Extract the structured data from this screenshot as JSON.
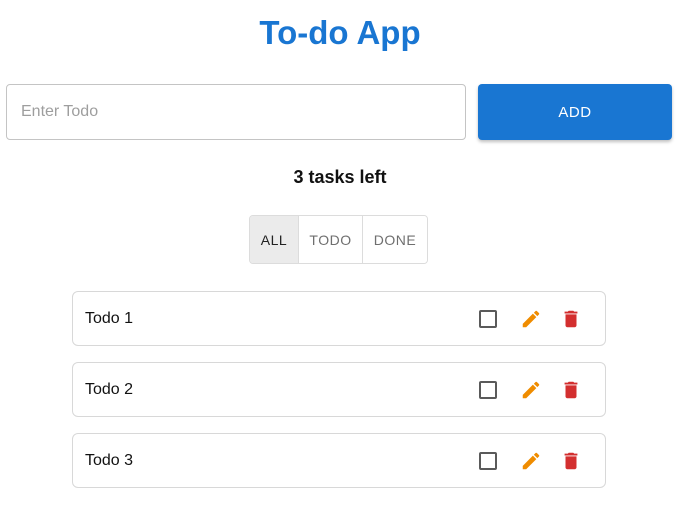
{
  "app": {
    "title": "To-do App"
  },
  "input": {
    "placeholder": "Enter Todo",
    "value": ""
  },
  "add_button": {
    "label": "ADD"
  },
  "status": {
    "tasks_left": "3 tasks left"
  },
  "filters": [
    {
      "label": "ALL",
      "selected": true
    },
    {
      "label": "TODO",
      "selected": false
    },
    {
      "label": "DONE",
      "selected": false
    }
  ],
  "todos": [
    {
      "text": "Todo 1",
      "done": false
    },
    {
      "text": "Todo 2",
      "done": false
    },
    {
      "text": "Todo 3",
      "done": false
    }
  ],
  "icons": {
    "edit": "pencil-icon",
    "delete": "trash-icon"
  },
  "colors": {
    "primary": "#1976d2",
    "edit": "#ef8c00",
    "delete": "#d32f2f",
    "checkbox": "#5a5a5a"
  }
}
